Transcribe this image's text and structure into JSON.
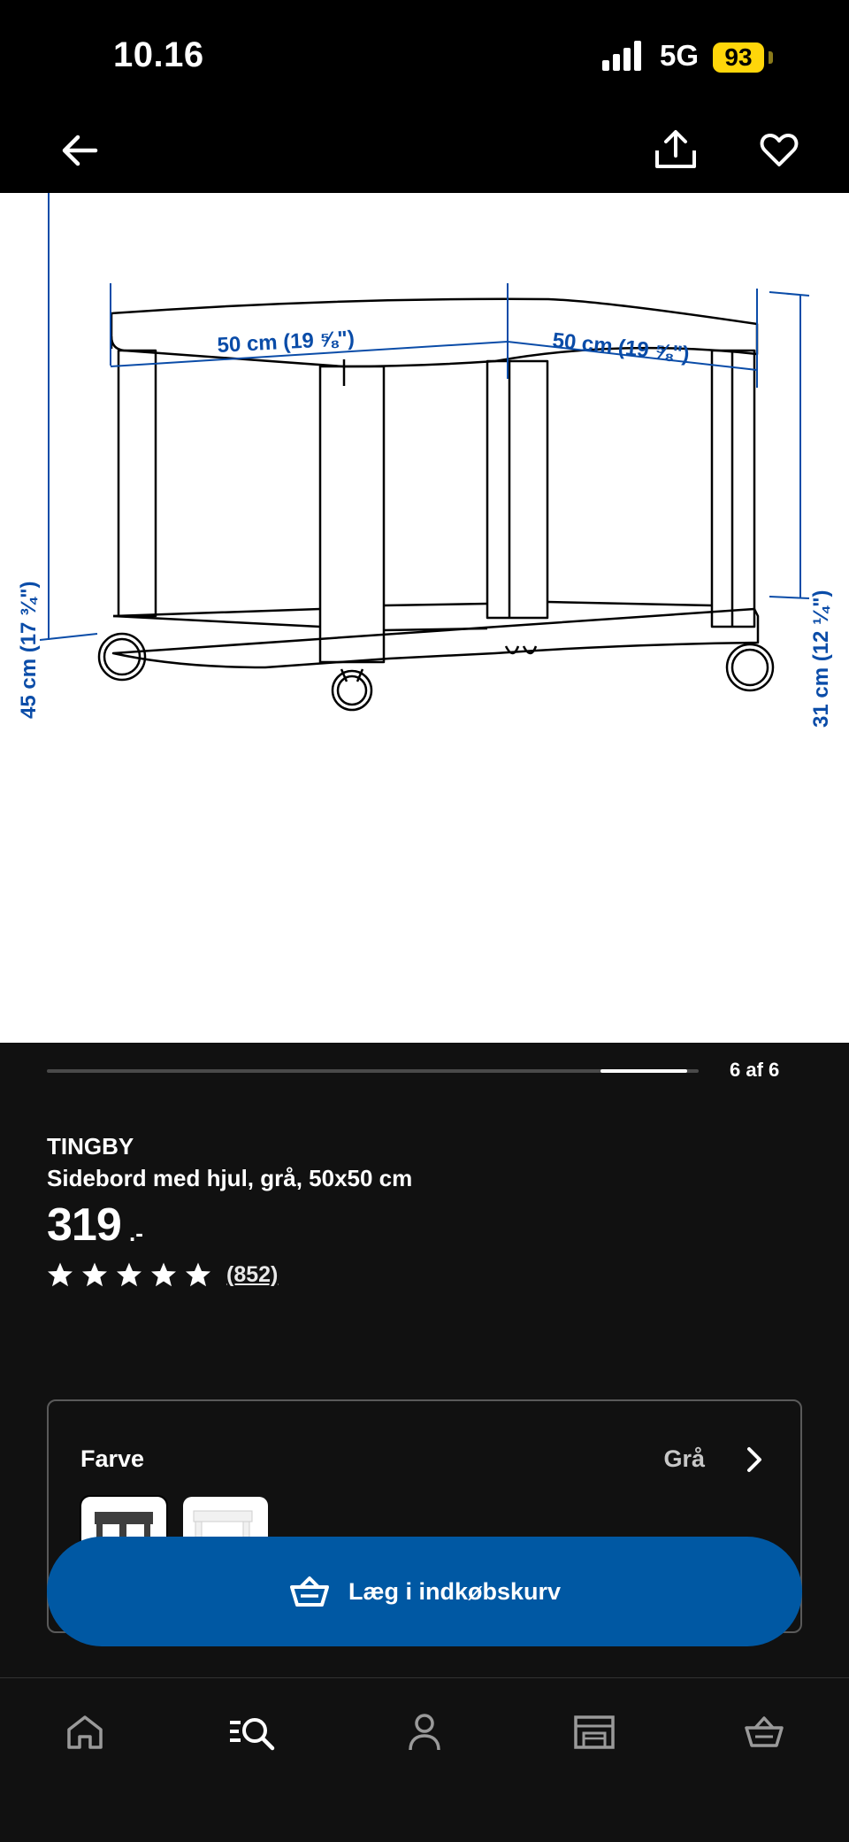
{
  "status_bar": {
    "time": "10.16",
    "network": "5G",
    "battery": "93"
  },
  "nav": {
    "back_icon": "arrow-left-icon",
    "share_icon": "share-icon",
    "favorite_icon": "heart-icon"
  },
  "product_image": {
    "dimensions": {
      "top_left": "50 cm (19 ⅝\")",
      "top_right": "50 cm (19 ⅝\")",
      "left_height": "45 cm (17 ¾\")",
      "right_height": "31 cm (12 ¼\")"
    },
    "line_color": "#000000",
    "dimension_color": "#0a4ca8"
  },
  "gallery": {
    "label": "6 af 6",
    "current": 6,
    "total": 6
  },
  "product": {
    "name": "TINGBY",
    "description": "Sidebord med hjul, grå, 50x50 cm",
    "price": "319",
    "price_suffix": ".-",
    "rating_stars": 5,
    "review_count": "(852)"
  },
  "color_selector": {
    "label": "Farve",
    "selected": "Grå",
    "swatches": [
      "Grå",
      "Hvid"
    ]
  },
  "cart_button": {
    "label": "Læg i indkøbskurv",
    "color": "#0058a3"
  },
  "tabbar": {
    "items": [
      "home-icon",
      "search-icon",
      "profile-icon",
      "store-icon",
      "cart-icon"
    ]
  }
}
